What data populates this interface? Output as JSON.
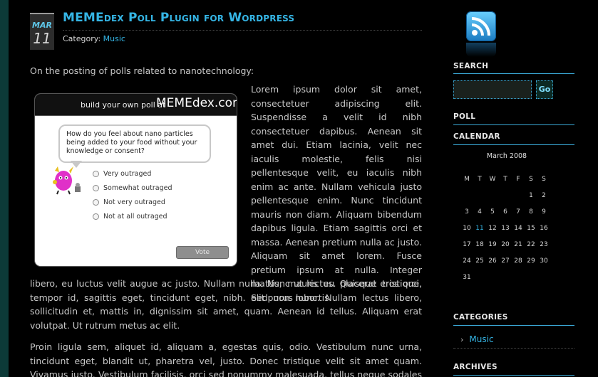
{
  "post": {
    "month": "MAR",
    "day": "11",
    "title": "MEMEdex Poll Plugin for Wordpress",
    "category_label": "Category:",
    "category_link": "Music",
    "intro": "On the posting of polls related to nanotechnology:",
    "poll_image": {
      "header_small": "build your own poll at",
      "header_brand": "MEMEdex.com",
      "question": "How do you feel about nano particles being added to your food without your knowledge or consent?",
      "options": [
        "Very outraged",
        "Somewhat outraged",
        "Not very outraged",
        "Not at all outraged"
      ],
      "vote_label": "Vote"
    },
    "paragraph_side": "Lorem ipsum dolor sit amet, consectetuer adipiscing elit. Suspendisse a velit id nibh consectetuer dapibus. Aenean sit amet dui. Etiam lacinia, velit nec iaculis molestie, felis nisi pellentesque velit, eu iaculis nibh enim ac ante. Nullam vehicula justo pellentesque enim. Nunc tincidunt mauris non diam. Aliquam bibendum dapibus ligula. Etiam sagittis orci et massa. Aenean pretium nulla ac justo. Aliquam sit amet lorem. Fusce pretium ipsum at nulla. Integer mattis, mauris eu placerat tristique, elit purus lobortis",
    "paragraph_wrap": "libero, eu luctus velit augue ac justo. Nullam nulla. Nunc ut lectus. Quisque eros orci, tempor id, sagittis eget, tincidunt eget, nibh. Sed non nunc. Nullam lectus libero, sollicitudin et, mattis in, dignissim sit amet, quam. Aenean id tellus. Aliquam erat volutpat. Ut rutrum metus ac elit.",
    "paragraph_2": "Proin ligula sem, aliquet id, aliquam a, egestas quis, odio. Vestibulum nunc urna, tincidunt eget, blandit ut, pharetra vel, justo. Donec tristique velit sit amet quam. Vivamus justo. Vestibulum facilisis, orci sed nonummy malesuada, tellus neque sodales risus, id cursus leo"
  },
  "sidebar": {
    "rss_icon": "rss-feed-icon",
    "search_heading": "SEARCH",
    "search_placeholder": "",
    "search_button": "Go",
    "poll_heading": "POLL",
    "calendar_heading": "CALENDAR",
    "calendar_caption": "March 2008",
    "weekdays": [
      "M",
      "T",
      "W",
      "T",
      "F",
      "S",
      "S"
    ],
    "weeks": [
      [
        "",
        "",
        "",
        "",
        "",
        "1",
        "2"
      ],
      [
        "3",
        "4",
        "5",
        "6",
        "7",
        "8",
        "9"
      ],
      [
        "10",
        "11",
        "12",
        "13",
        "14",
        "15",
        "16"
      ],
      [
        "17",
        "18",
        "19",
        "20",
        "21",
        "22",
        "23"
      ],
      [
        "24",
        "25",
        "26",
        "27",
        "28",
        "29",
        "30"
      ],
      [
        "31",
        "",
        "",
        "",
        "",
        "",
        ""
      ]
    ],
    "today": "11",
    "categories_heading": "CATEGORIES",
    "categories": [
      "Music"
    ],
    "archives_heading": "ARCHIVES"
  },
  "colors": {
    "background": "#000000",
    "outer_background": "#0c3a38",
    "accent": "#35b5e5",
    "text": "#c8c8c8"
  }
}
